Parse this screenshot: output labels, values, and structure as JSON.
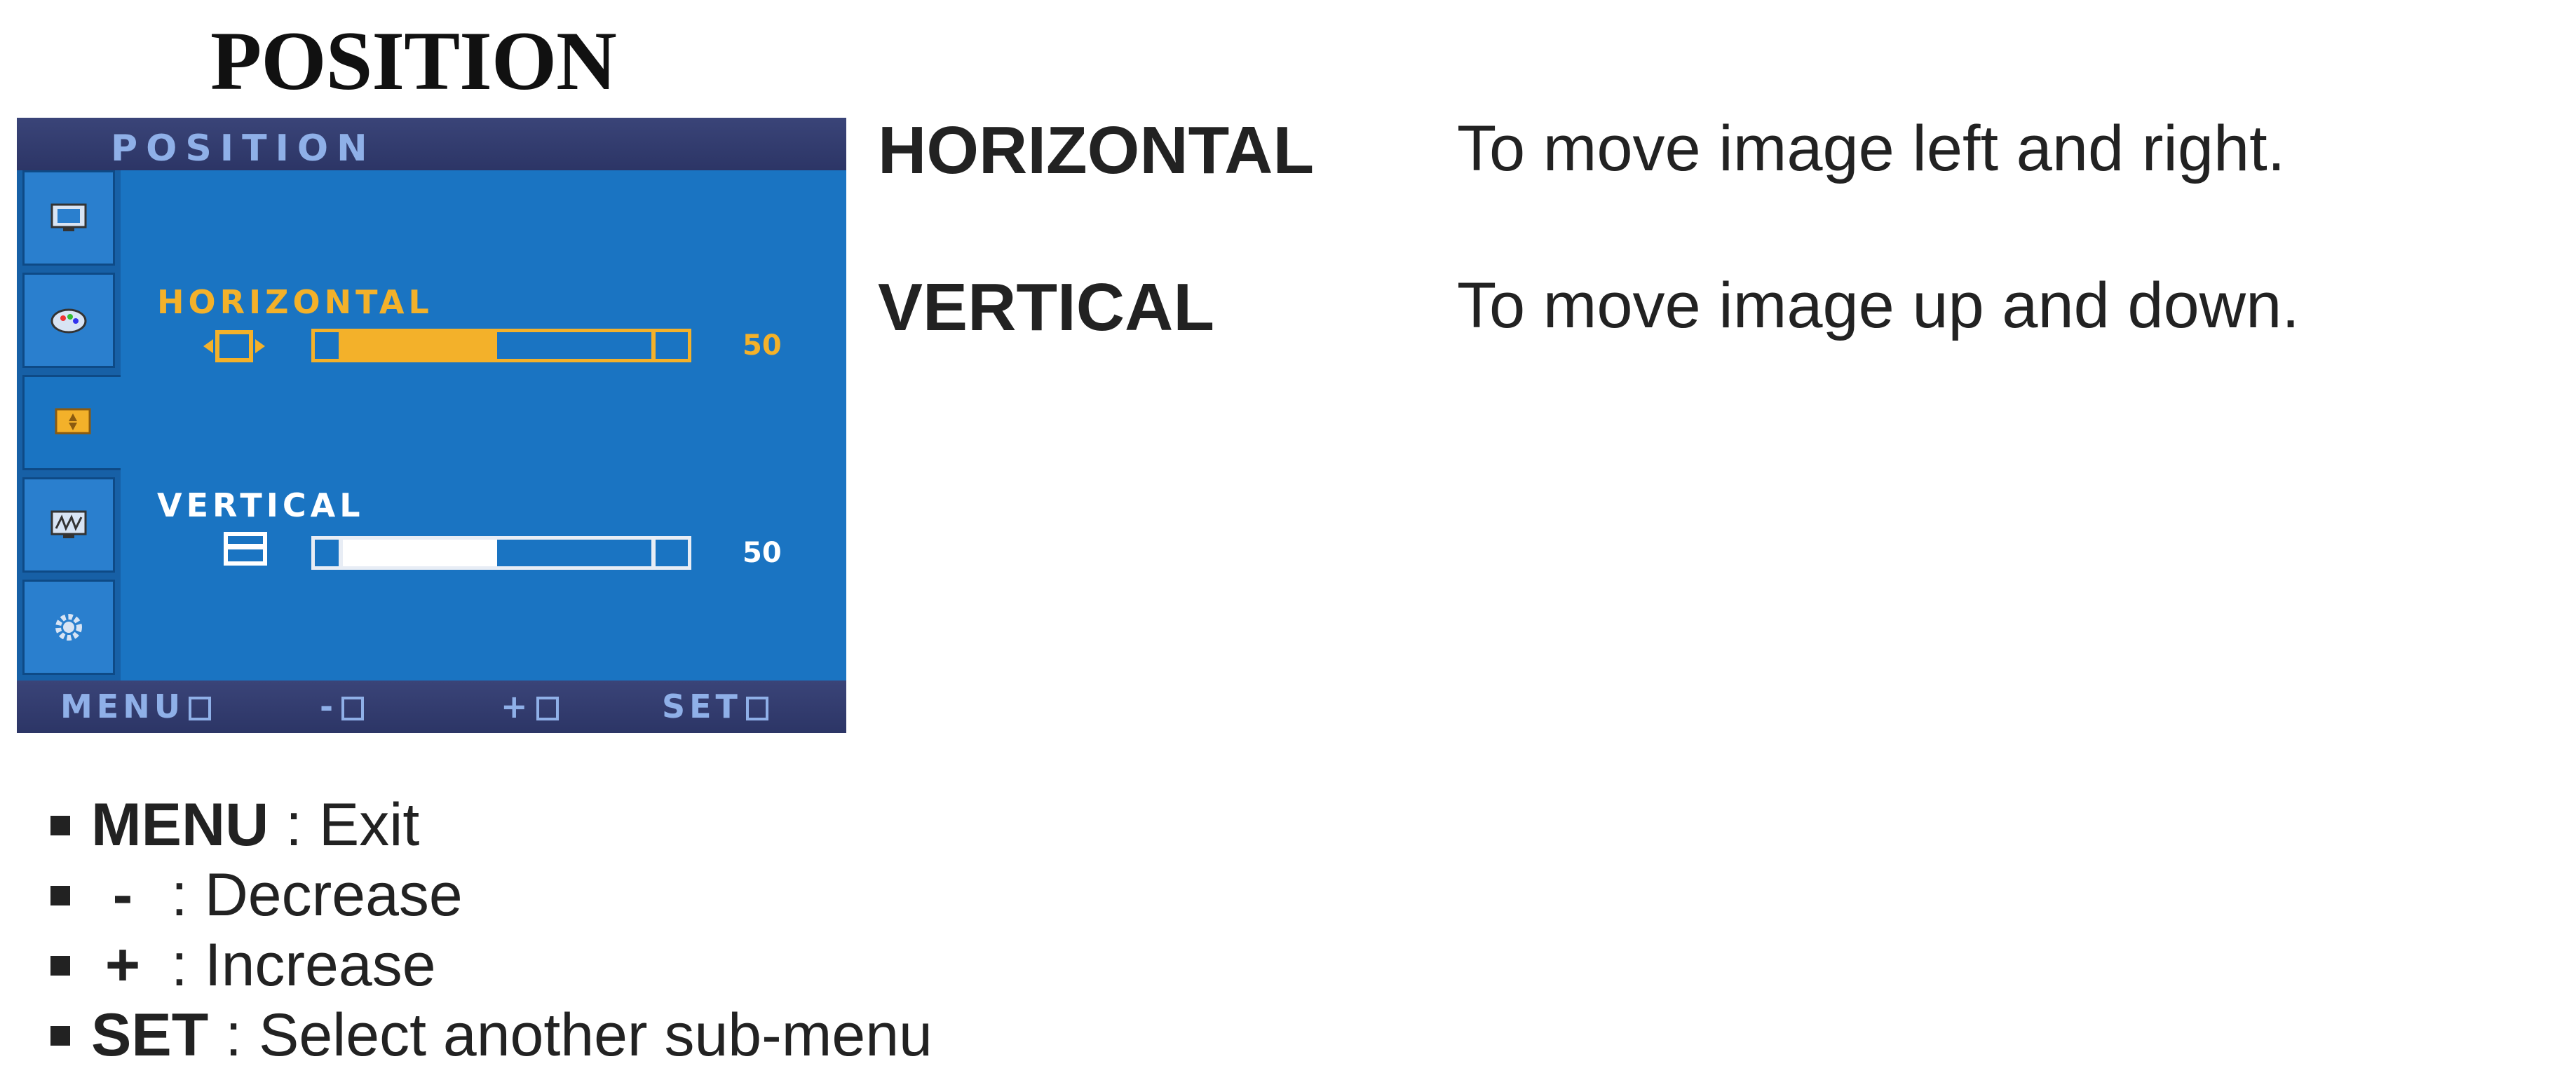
{
  "page": {
    "title": "POSITION"
  },
  "osd": {
    "header_title": "POSITION",
    "sidebar_tabs": [
      {
        "icon": "picture-icon",
        "active": false
      },
      {
        "icon": "color-icon",
        "active": false
      },
      {
        "icon": "position-icon",
        "active": true
      },
      {
        "icon": "tracking-icon",
        "active": false
      },
      {
        "icon": "setup-gear-icon",
        "active": false
      }
    ],
    "controls": [
      {
        "label": "HORIZONTAL",
        "value_text": "50",
        "level": 0.5,
        "color": "#f3b12a"
      },
      {
        "label": "VERTICAL",
        "value_text": "50",
        "level": 0.5,
        "color": "#ffffff"
      }
    ],
    "footer": {
      "menu": "MENU",
      "minus": "-",
      "plus": "+",
      "set": "SET"
    },
    "colors": {
      "screen": "#1a74c2",
      "bar": "#2c3566",
      "accent": "#f3b12a"
    }
  },
  "description": [
    {
      "term": "HORIZONTAL",
      "text": "To move image left and right."
    },
    {
      "term": "VERTICAL",
      "text": "To move image up and down."
    }
  ],
  "legend": [
    {
      "key": "MENU",
      "text": ": Exit"
    },
    {
      "key": "-",
      "text": ": Decrease"
    },
    {
      "key": "+",
      "text": ": Increase"
    },
    {
      "key": "SET",
      "text": ": Select another sub-menu"
    }
  ]
}
